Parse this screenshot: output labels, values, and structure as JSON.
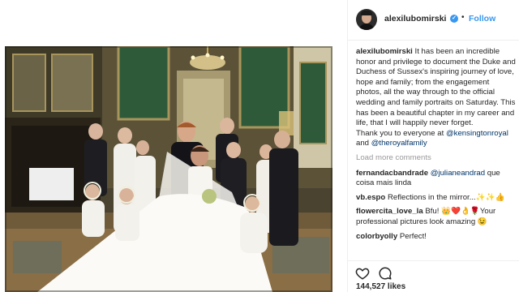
{
  "header": {
    "username": "alexilubomirski",
    "verified_icon": "verified-badge-icon",
    "separator": "•",
    "follow_label": "Follow"
  },
  "caption": {
    "username": "alexilubomirski",
    "text": "It has been an incredible honor and privilege to document the Duke and Duchess of Sussex's inspiring journey of love, hope and family; from the engagement photos, all the way through to the official wedding and family portraits on Saturday. This has been a beautiful chapter in my career and life, that I will happily never forget.",
    "thanks": "Thank you to everyone at",
    "mention1": "@kensingtonroyal",
    "and": "and",
    "mention2": "@theroyalfamily"
  },
  "load_more": "Load more comments",
  "comments": [
    {
      "username": "fernandacbandrade",
      "mention": "@julianeandrad",
      "text": "que coisa mais linda"
    },
    {
      "username": "vb.espo",
      "text": "Reflections in the mirror...✨✨👍"
    },
    {
      "username": "flowercita_love_la",
      "text": "Bfu! 👑❤️👌🌹Your professional pictures look amazing 😉"
    },
    {
      "username": "colorbyolly",
      "text": "Perfect!"
    }
  ],
  "actions": {
    "like_icon": "heart-icon",
    "comment_icon": "comment-bubble-icon"
  },
  "likes": "144,527 likes",
  "colors": {
    "link": "#003569",
    "follow": "#3897f0",
    "text": "#262626",
    "muted": "#999999"
  }
}
